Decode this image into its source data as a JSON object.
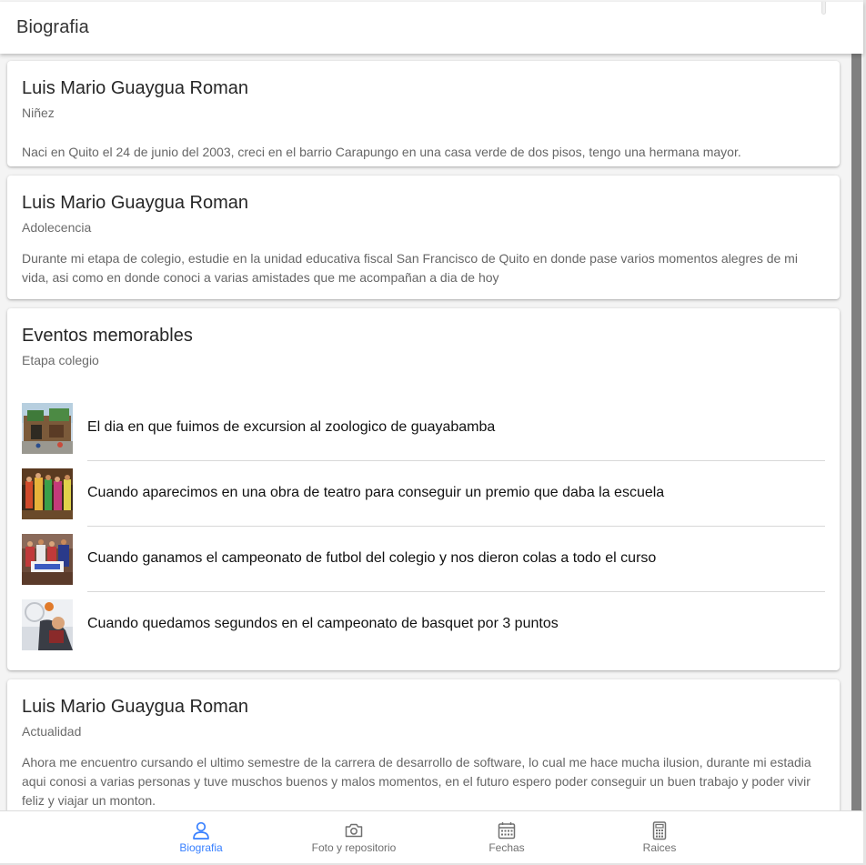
{
  "header": {
    "title": "Biografia"
  },
  "cards": [
    {
      "title": "Luis Mario Guaygua Roman",
      "subtitle": "Niñez",
      "body": "Naci en Quito el 24 de junio del 2003, creci en el barrio Carapungo en una casa verde de dos pisos, tengo una hermana mayor."
    },
    {
      "title": "Luis Mario Guaygua Roman",
      "subtitle": "Adolecencia",
      "body": "Durante mi etapa de colegio, estudie en la unidad educativa fiscal San Francisco de Quito en donde pase varios momentos alegres de mi vida, asi como en donde conoci a varias amistades que me acompañan a dia de hoy"
    },
    {
      "title": "Luis Mario Guaygua Roman",
      "subtitle": "Actualidad",
      "body": "Ahora me encuentro cursando el ultimo semestre de la carrera de desarrollo de software, lo cual me hace mucha ilusion, durante mi estadia aqui conosi a varias personas y tuve muschos buenos y malos momentos, en el futuro espero poder conseguir un buen trabajo y poder vivir feliz y viajar un monton."
    }
  ],
  "events": {
    "title": "Eventos memorables",
    "subtitle": "Etapa colegio",
    "items": [
      {
        "text": "El dia en que fuimos de excursion al zoologico de guayabamba",
        "thumb": "zoo-entrance-photo"
      },
      {
        "text": "Cuando aparecimos en una obra de teatro para conseguir un premio que daba la escuela",
        "thumb": "theater-play-photo"
      },
      {
        "text": "Cuando ganamos el campeonato de futbol del colegio y nos dieron colas a todo el curso",
        "thumb": "football-team-photo"
      },
      {
        "text": "Cuando quedamos segundos en el campeonato de basquet por 3 puntos",
        "thumb": "basketball-photo"
      }
    ]
  },
  "tabs": [
    {
      "label": "Biografia",
      "icon": "person-icon",
      "active": true
    },
    {
      "label": "Foto y repositorio",
      "icon": "camera-icon",
      "active": false
    },
    {
      "label": "Fechas",
      "icon": "calendar-icon",
      "active": false
    },
    {
      "label": "Raices",
      "icon": "calculator-icon",
      "active": false
    }
  ],
  "colors": {
    "accent": "#3880ff",
    "inactive": "#707070",
    "background": "#f4f4f4"
  }
}
